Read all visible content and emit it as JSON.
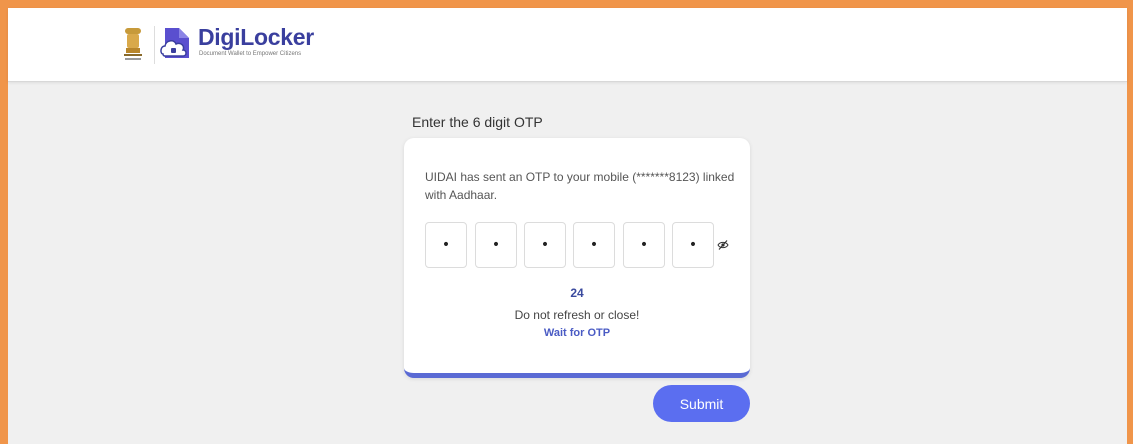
{
  "brand": {
    "name": "DigiLocker",
    "tagline": "Document Wallet to Empower Citizens"
  },
  "otp": {
    "title": "Enter the 6 digit OTP",
    "message": "UIDAI has sent an OTP to your mobile (*******8123) linked with Aadhaar.",
    "digits": [
      "•",
      "•",
      "•",
      "•",
      "•",
      "•"
    ],
    "timer": "24",
    "warning": "Do not refresh or close!",
    "wait_label": "Wait for OTP"
  },
  "actions": {
    "submit_label": "Submit"
  },
  "colors": {
    "frame": "#f0954a",
    "brand": "#3a3f9e",
    "accent": "#5b6ef0",
    "card_border": "#5a6ad4"
  },
  "icons": {
    "emblem": "national-emblem-icon",
    "logo": "digilocker-cloud-icon",
    "visibility": "eye-slash-icon"
  }
}
